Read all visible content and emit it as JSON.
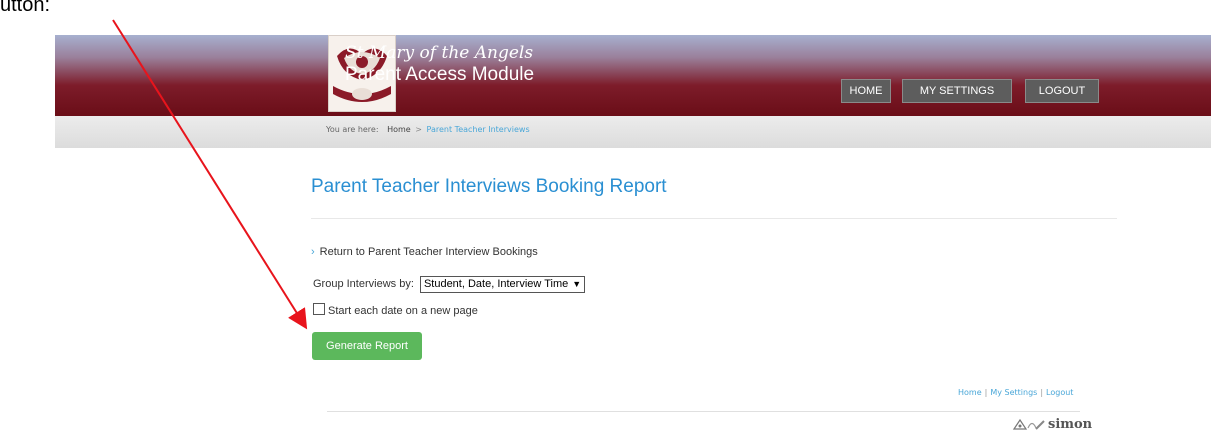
{
  "caption": "utton:",
  "header": {
    "school_name": "St Mary of the Angels",
    "module_name": "Parent Access Module",
    "nav": [
      {
        "label": "HOME"
      },
      {
        "label": "MY SETTINGS"
      },
      {
        "label": "LOGOUT"
      }
    ]
  },
  "breadcrumb": {
    "label": "You are here:",
    "home": "Home",
    "separator": ">",
    "current": "Parent Teacher Interviews"
  },
  "main": {
    "title": "Parent Teacher Interviews Booking Report",
    "return_link": "Return to Parent Teacher Interview Bookings",
    "group_label": "Group Interviews by:",
    "group_value": "Student, Date, Interview Time",
    "checkbox_label": "Start each date on a new page",
    "checkbox_checked": false,
    "generate_button": "Generate Report"
  },
  "footer": {
    "links": [
      "Home",
      "My Settings",
      "Logout"
    ],
    "separator": "|",
    "brand": "simon"
  },
  "annotation": {
    "arrow_color": "#e8141c"
  },
  "colors": {
    "header_dark": "#6a0d17",
    "title_blue": "#2a8fd2",
    "button_green": "#5cb85c"
  }
}
